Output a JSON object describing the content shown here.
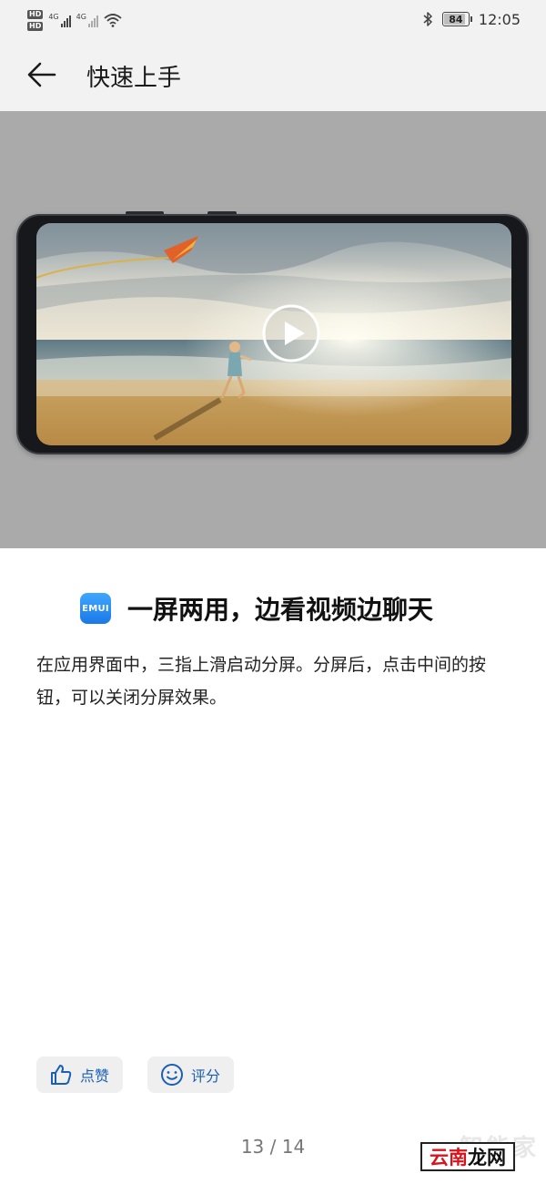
{
  "status_bar": {
    "network_left": "4G",
    "network_right": "4G",
    "battery_level": "84",
    "time": "12:05"
  },
  "app_bar": {
    "title": "快速上手"
  },
  "media": {
    "icons": [
      "play-icon"
    ]
  },
  "feature": {
    "badge": "EMUI",
    "heading": "一屏两用，边看视频边聊天",
    "description": "在应用界面中，三指上滑启动分屏。分屏后，点击中间的按钮，可以关闭分屏效果。"
  },
  "actions": {
    "like_label": "点赞",
    "rate_label": "评分"
  },
  "pager": {
    "text": "13 / 14"
  },
  "watermark": {
    "ghost": "智能家",
    "part_red": "云南",
    "part_black": "龙网"
  },
  "colors": {
    "accent": "#1a5fb4",
    "media_bg": "#aaaaaa"
  }
}
